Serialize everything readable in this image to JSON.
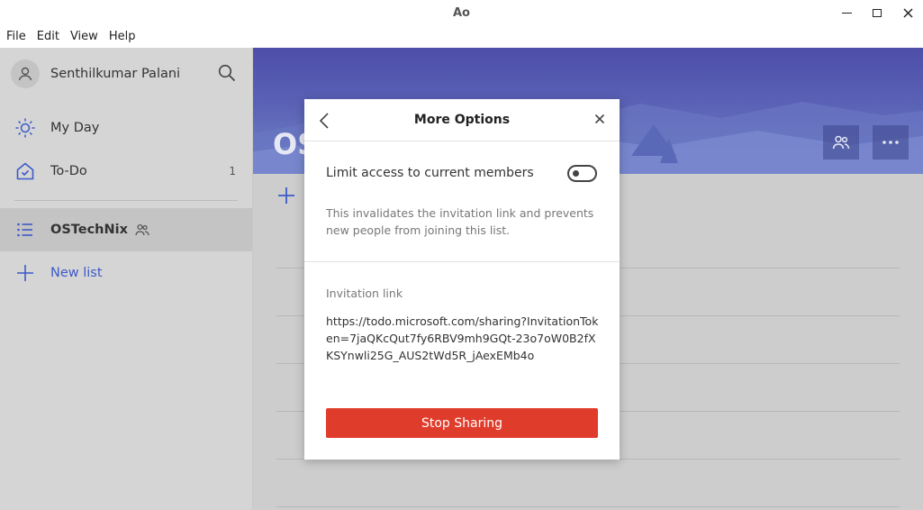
{
  "window": {
    "title": "Ao"
  },
  "menu": {
    "file": "File",
    "edit": "Edit",
    "view": "View",
    "help": "Help"
  },
  "sidebar": {
    "user_name": "Senthilkumar Palani",
    "items": [
      {
        "label": "My Day",
        "icon": "sun-icon",
        "count": ""
      },
      {
        "label": "To-Do",
        "icon": "home-icon",
        "count": "1"
      },
      {
        "label": "OSTechNix",
        "icon": "list-icon",
        "shared_icon": "people-icon"
      },
      {
        "label": "New list",
        "icon": "plus-icon"
      }
    ]
  },
  "main": {
    "list_title": "OS"
  },
  "dialog": {
    "title": "More Options",
    "limit_label": "Limit access to current members",
    "limit_toggle_on": false,
    "limit_description": "This invalidates the invitation link and prevents new people from joining this list.",
    "invitation_label": "Invitation link",
    "invitation_link": "https://todo.microsoft.com/sharing?InvitationToken=7jaQKcQut7fy6RBV9mh9GQt-23o7oW0B2fXKSYnwli25G_AUS2tWd5R_jAexEMb4o",
    "stop_sharing_label": "Stop Sharing"
  },
  "colors": {
    "accent": "#3d5ac9",
    "danger": "#e03c2c",
    "sidebar_bg": "#d5d5d5"
  }
}
